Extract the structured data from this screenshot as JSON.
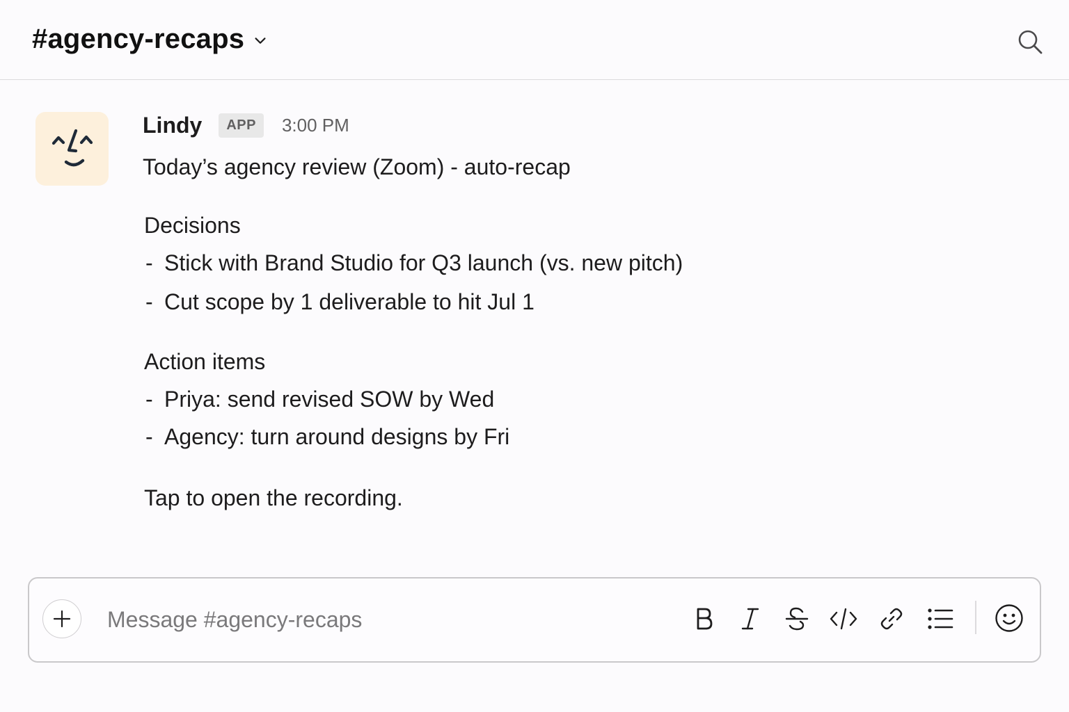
{
  "header": {
    "channel_name": "#agency-recaps",
    "chevron_icon": "chevron-down-icon",
    "search_icon": "search-icon"
  },
  "message": {
    "sender": "Lindy",
    "badge": "APP",
    "timestamp": "3:00 PM",
    "avatar_icon": "lindy-face-icon",
    "avatar_bg": "#fdf0dc",
    "title": "Today’s agency review (Zoom) - auto-recap",
    "decisions_heading": "Decisions",
    "decisions": [
      "Stick with Brand Studio for Q3 launch (vs. new pitch)",
      "Cut scope by 1 deliverable to hit Jul 1"
    ],
    "actions_heading": "Action items",
    "actions": [
      "Priya: send revised SOW by Wed",
      "Agency: turn around designs by Fri"
    ],
    "footer": "Tap to open the recording.",
    "bullet_marker": "-"
  },
  "composer": {
    "placeholder": "Message #agency-recaps",
    "value": "",
    "tools": [
      "add-icon",
      "bold-icon",
      "italic-icon",
      "strikethrough-icon",
      "code-icon",
      "link-icon",
      "bulleted-list-icon",
      "emoji-icon"
    ]
  }
}
